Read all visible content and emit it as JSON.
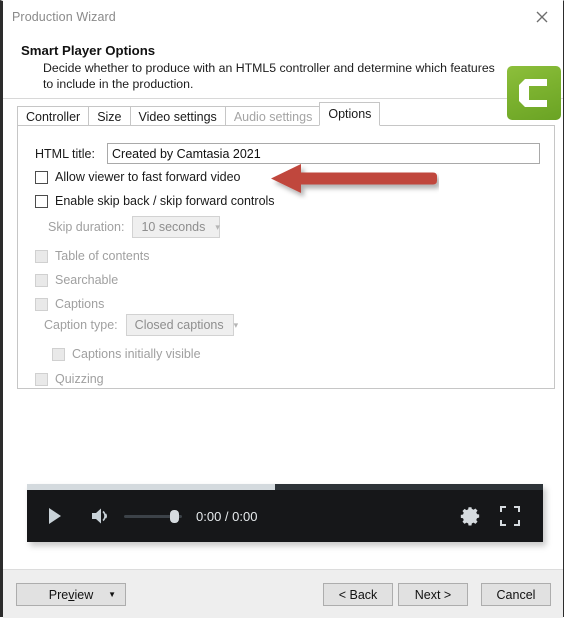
{
  "window": {
    "title": "Production Wizard",
    "close_icon": "close-icon"
  },
  "header": {
    "title": "Smart Player Options",
    "description": "Decide whether to produce with an HTML5 controller and determine which features to include in the production.",
    "logo_name": "camtasia-logo",
    "logo_color": "#7cb22f"
  },
  "tabs": [
    {
      "label": "Controller",
      "state": "enabled"
    },
    {
      "label": "Size",
      "state": "enabled"
    },
    {
      "label": "Video settings",
      "state": "enabled"
    },
    {
      "label": "Audio settings",
      "state": "disabled"
    },
    {
      "label": "Options",
      "state": "active"
    }
  ],
  "options": {
    "html_title_label": "HTML title:",
    "html_title_value": "Created by Camtasia 2021",
    "html_title_placeholder": "Created by Camtasia 2021",
    "fast_forward_label": "Allow viewer to fast forward video",
    "fast_forward_checked": false,
    "skip_controls_label": "Enable skip back / skip forward controls",
    "skip_controls_checked": false,
    "skip_duration_label": "Skip duration:",
    "skip_duration_value": "10 seconds",
    "table_of_contents_label": "Table of contents",
    "table_of_contents_checked": false,
    "searchable_label": "Searchable",
    "searchable_checked": false,
    "captions_label": "Captions",
    "captions_checked": false,
    "caption_type_label": "Caption type:",
    "caption_type_value": "Closed captions",
    "captions_initially_visible_label": "Captions initially visible",
    "captions_initially_visible_checked": false,
    "quizzing_label": "Quizzing",
    "quizzing_checked": false
  },
  "annotation": {
    "name": "red-left-arrow",
    "color": "#c0463c",
    "points_to": "Allow viewer to fast forward video"
  },
  "player": {
    "play_icon": "play-icon",
    "volume_icon": "volume-icon",
    "settings_icon": "gear-icon",
    "fullscreen_icon": "fullscreen-icon",
    "time_display": "0:00 / 0:00",
    "progress_percent": 48,
    "volume_percent": 80,
    "background_color": "#161719"
  },
  "footer": {
    "preview_label_a": "Pre",
    "preview_label_u": "v",
    "preview_label_b": "iew",
    "preview_caret": "▼",
    "back_label": "< Back",
    "next_label": "Next >",
    "cancel_label": "Cancel"
  }
}
